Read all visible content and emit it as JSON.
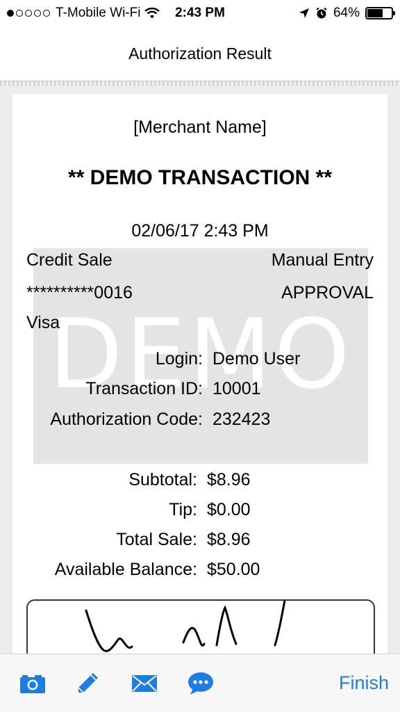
{
  "status_bar": {
    "carrier": "T-Mobile Wi-Fi",
    "time": "2:43 PM",
    "battery": "64%",
    "signal_bars_filled": 1,
    "signal_bars_total": 5
  },
  "header": {
    "title": "Authorization Result"
  },
  "receipt": {
    "merchant_name": "[Merchant Name]",
    "demo_title": "** DEMO TRANSACTION **",
    "datetime": "02/06/17 2:43 PM",
    "transaction_type": "Credit Sale",
    "entry_mode": "Manual Entry",
    "card_number": "**********0016",
    "status": "APPROVAL",
    "card_type": "Visa",
    "watermark": "DEMO",
    "details": [
      {
        "label": "Login:",
        "value": "Demo User"
      },
      {
        "label": "Transaction ID:",
        "value": "10001"
      },
      {
        "label": "Authorization Code:",
        "value": "232423"
      }
    ],
    "totals": [
      {
        "label": "Subtotal:",
        "value": "$8.96"
      },
      {
        "label": "Tip:",
        "value": "$0.00"
      },
      {
        "label": "Total Sale:",
        "value": "$8.96"
      },
      {
        "label": "Available Balance:",
        "value": "$50.00"
      }
    ]
  },
  "toolbar": {
    "icons": [
      "camera-icon",
      "pencil-icon",
      "mail-icon",
      "chat-bubble-icon"
    ],
    "finish_label": "Finish",
    "accent_color": "#1a7ee6"
  }
}
